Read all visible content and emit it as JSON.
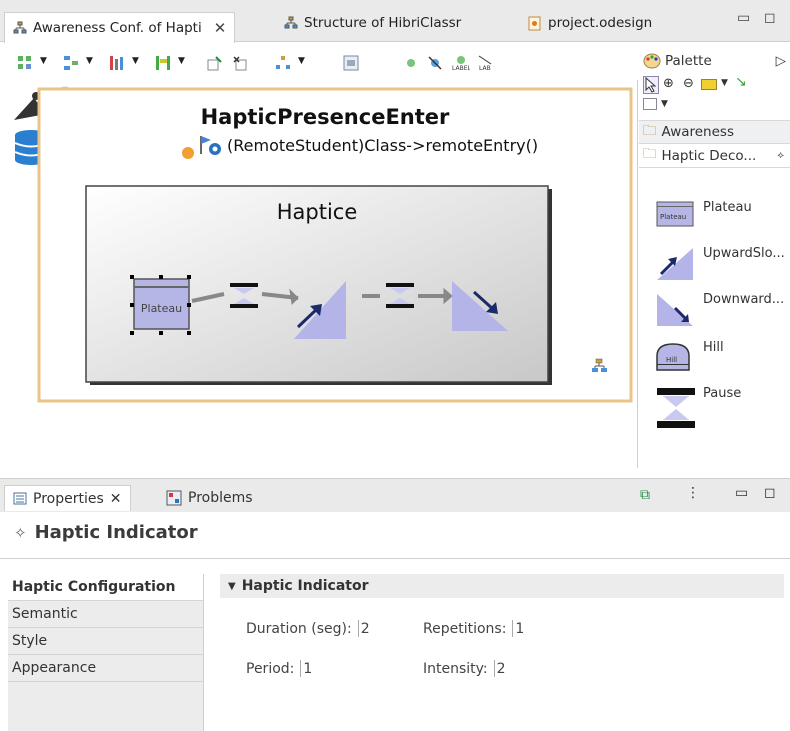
{
  "editor_tabs": [
    {
      "label": "Awareness Conf. of Hapti",
      "active": true
    },
    {
      "label": "Structure of HibriClassr",
      "active": false
    },
    {
      "label": "project.odesign",
      "active": false
    }
  ],
  "canvas": {
    "container_title": "HapticPresenceEnter",
    "container_subtitle": "(RemoteStudent)Class->remoteEntry()",
    "inner_title": "Haptice",
    "selected_node_label": "Plateau"
  },
  "palette": {
    "title": "Palette",
    "drawers": [
      "Awareness",
      "Haptic Deco..."
    ],
    "items": [
      {
        "label": "Plateau",
        "icon": "plateau-icon"
      },
      {
        "label": "UpwardSlo...",
        "icon": "upward-slope-icon"
      },
      {
        "label": "Downward...",
        "icon": "downward-slope-icon"
      },
      {
        "label": "Hill",
        "icon": "hill-icon"
      },
      {
        "label": "Pause",
        "icon": "pause-icon"
      }
    ]
  },
  "bottom_tabs": [
    {
      "label": "Properties",
      "active": true
    },
    {
      "label": "Problems",
      "active": false
    }
  ],
  "properties": {
    "title": "Haptic Indicator",
    "side_tabs": [
      "Haptic Configuration",
      "Semantic",
      "Style",
      "Appearance"
    ],
    "section": "Haptic Indicator",
    "fields": {
      "duration_label": "Duration (seg):",
      "duration_value": "2",
      "repetitions_label": "Repetitions:",
      "repetitions_value": "1",
      "period_label": "Period:",
      "period_value": "1",
      "intensity_label": "Intensity:",
      "intensity_value": "2"
    }
  },
  "colors": {
    "container_border": "#e8c48a",
    "node_fill": "#b6b6e6",
    "highlight_bar": "#ececec"
  }
}
